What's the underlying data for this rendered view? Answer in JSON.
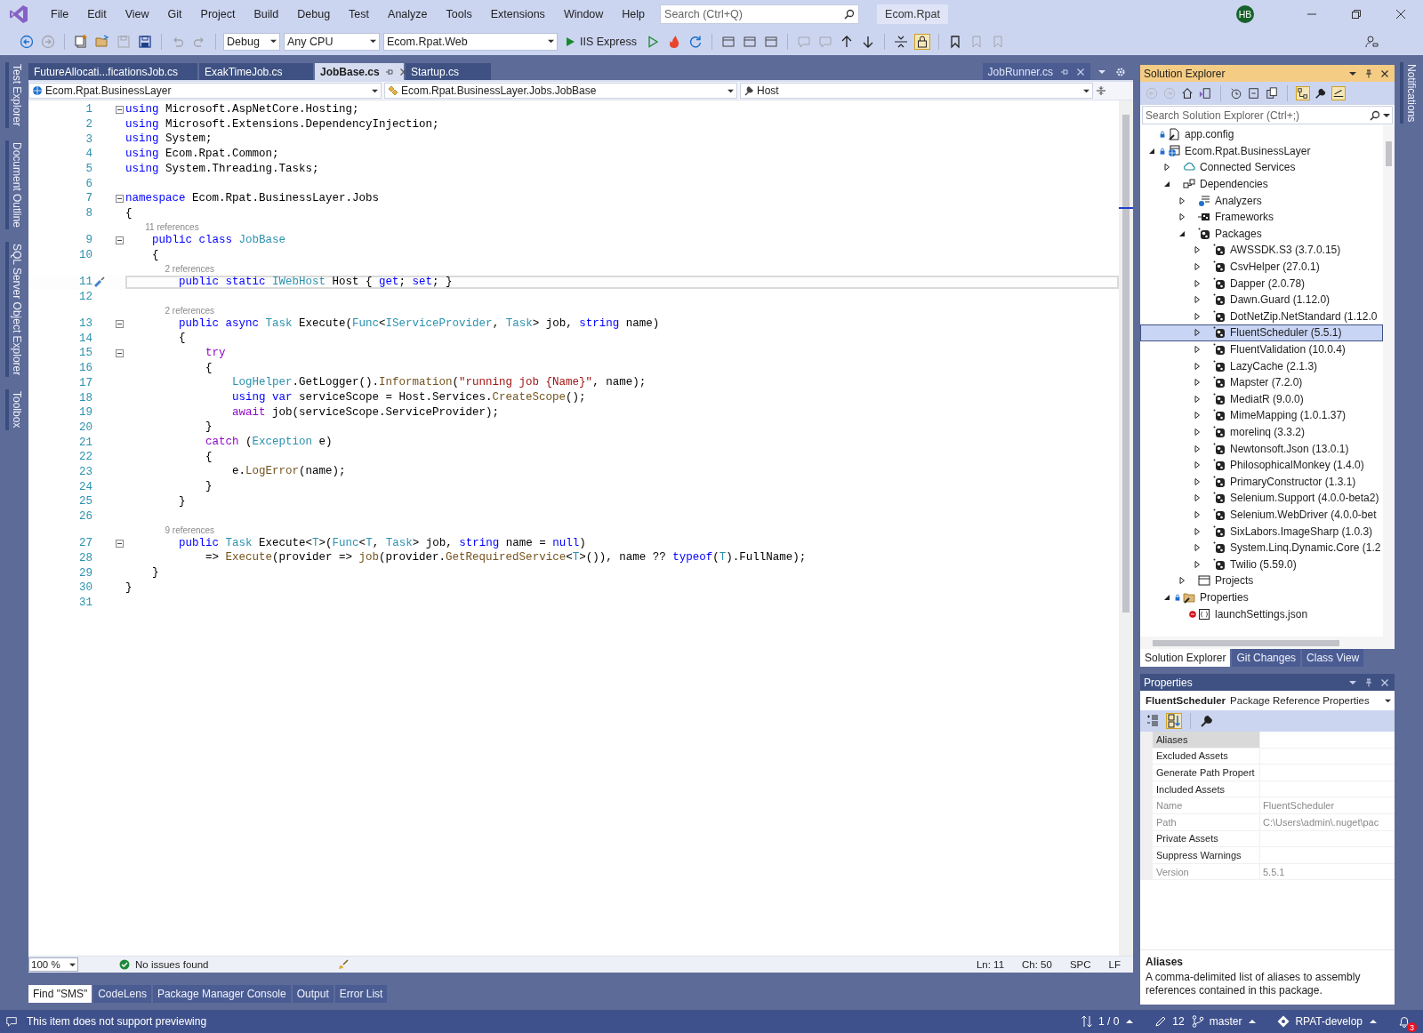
{
  "menu_bar": {
    "items": [
      "File",
      "Edit",
      "View",
      "Git",
      "Project",
      "Build",
      "Debug",
      "Test",
      "Analyze",
      "Tools",
      "Extensions",
      "Window",
      "Help"
    ],
    "search": {
      "placeholder": "Search (Ctrl+Q)"
    },
    "solution_name": "Ecom.Rpat",
    "user_initials": "HB"
  },
  "toolbar": {
    "configuration": "Debug",
    "platform": "Any CPU",
    "startup_project": "Ecom.Rpat.Web",
    "run_target": "IIS Express"
  },
  "left_tool_tabs": [
    "Test Explorer",
    "Document Outline",
    "SQL Server Object Explorer",
    "Toolbox"
  ],
  "right_tool_tabs": [
    "Notifications"
  ],
  "editor": {
    "tabs": [
      {
        "label": "FutureAllocati...ficationsJob.cs",
        "selected": false
      },
      {
        "label": "ExakTimeJob.cs",
        "selected": false
      },
      {
        "label": "JobBase.cs",
        "selected": true
      },
      {
        "label": "Startup.cs",
        "selected": false
      }
    ],
    "preview_tab": {
      "label": "JobRunner.cs"
    },
    "nav": {
      "project": "Ecom.Rpat.BusinessLayer",
      "type": "Ecom.Rpat.BusinessLayer.Jobs.JobBase",
      "member": "Host"
    },
    "lines": [
      {
        "kind": "code",
        "number": "1",
        "foldable": true,
        "current": false,
        "tokens": [
          {
            "t": "using",
            "kind": "kw"
          },
          {
            "t": " Microsoft.AspNetCore.Hosting;",
            "kind": "plain"
          }
        ]
      },
      {
        "kind": "code",
        "number": "2",
        "foldable": false,
        "current": false,
        "tokens": [
          {
            "t": "using",
            "kind": "kw"
          },
          {
            "t": " Microsoft.Extensions.DependencyInjection;",
            "kind": "plain"
          }
        ]
      },
      {
        "kind": "code",
        "number": "3",
        "foldable": false,
        "current": false,
        "tokens": [
          {
            "t": "using",
            "kind": "kw"
          },
          {
            "t": " System;",
            "kind": "plain"
          }
        ]
      },
      {
        "kind": "code",
        "number": "4",
        "foldable": false,
        "current": false,
        "tokens": [
          {
            "t": "using",
            "kind": "kw"
          },
          {
            "t": " Ecom.Rpat.Common;",
            "kind": "plain"
          }
        ]
      },
      {
        "kind": "code",
        "number": "5",
        "foldable": false,
        "current": false,
        "tokens": [
          {
            "t": "using",
            "kind": "kw"
          },
          {
            "t": " System.Threading.Tasks;",
            "kind": "plain"
          }
        ]
      },
      {
        "kind": "code",
        "number": "6",
        "foldable": false,
        "current": false
      },
      {
        "kind": "code",
        "number": "7",
        "foldable": true,
        "current": false,
        "tokens": [
          {
            "t": "namespace",
            "kind": "kw"
          },
          {
            "t": " Ecom.Rpat.BusinessLayer.Jobs",
            "kind": "plain"
          }
        ]
      },
      {
        "kind": "code",
        "number": "8",
        "foldable": false,
        "current": false,
        "tokens": [
          {
            "t": "{",
            "kind": "plain"
          }
        ]
      },
      {
        "kind": "lens",
        "text": "11 references"
      },
      {
        "kind": "code",
        "number": "9",
        "foldable": true,
        "current": false,
        "tokens": [
          {
            "t": "    public class",
            "kind": "kw"
          },
          {
            "t": " JobBase",
            "kind": "type"
          }
        ]
      },
      {
        "kind": "code",
        "number": "10",
        "foldable": false,
        "current": false,
        "tokens": [
          {
            "t": "    {",
            "kind": "plain"
          }
        ]
      },
      {
        "kind": "lens",
        "text": "2 references"
      },
      {
        "kind": "code",
        "number": "11",
        "foldable": false,
        "current": true,
        "tokens": [
          {
            "t": "        public static",
            "kind": "kw"
          },
          {
            "t": " IWebHost",
            "kind": "type"
          },
          {
            "t": " Host { ",
            "kind": "plain"
          },
          {
            "t": "get",
            "kind": "kw"
          },
          {
            "t": "; ",
            "kind": "plain"
          },
          {
            "t": "set",
            "kind": "kw"
          },
          {
            "t": "; }",
            "kind": "plain"
          }
        ]
      },
      {
        "kind": "code",
        "number": "12",
        "foldable": false,
        "current": false
      },
      {
        "kind": "lens",
        "text": "2 references"
      },
      {
        "kind": "code",
        "number": "13",
        "foldable": true,
        "current": false,
        "tokens": [
          {
            "t": "        public async",
            "kind": "kw"
          },
          {
            "t": " Task",
            "kind": "type"
          },
          {
            "t": " Execute(",
            "kind": "plain"
          },
          {
            "t": "Func",
            "kind": "type"
          },
          {
            "t": "<",
            "kind": "plain"
          },
          {
            "t": "IServiceProvider",
            "kind": "type"
          },
          {
            "t": ", ",
            "kind": "plain"
          },
          {
            "t": "Task",
            "kind": "type"
          },
          {
            "t": "> job, ",
            "kind": "plain"
          },
          {
            "t": "string",
            "kind": "kw"
          },
          {
            "t": " name)",
            "kind": "plain"
          }
        ]
      },
      {
        "kind": "code",
        "number": "14",
        "foldable": false,
        "current": false,
        "tokens": [
          {
            "t": "        {",
            "kind": "plain"
          }
        ]
      },
      {
        "kind": "code",
        "number": "15",
        "foldable": true,
        "current": false,
        "tokens": [
          {
            "t": "            try",
            "kind": "ctl"
          }
        ]
      },
      {
        "kind": "code",
        "number": "16",
        "foldable": false,
        "current": false,
        "tokens": [
          {
            "t": "            {",
            "kind": "plain"
          }
        ]
      },
      {
        "kind": "code",
        "number": "17",
        "foldable": false,
        "current": false,
        "tokens": [
          {
            "t": "                LogHelper",
            "kind": "type"
          },
          {
            "t": ".GetLogger().",
            "kind": "plain"
          },
          {
            "t": "Information",
            "kind": "method"
          },
          {
            "t": "(",
            "kind": "plain"
          },
          {
            "t": "\"running job {Name}\"",
            "kind": "str"
          },
          {
            "t": ", name);",
            "kind": "plain"
          }
        ]
      },
      {
        "kind": "code",
        "number": "18",
        "foldable": false,
        "current": false,
        "tokens": [
          {
            "t": "                using var",
            "kind": "kw"
          },
          {
            "t": " serviceScope = Host.Services.",
            "kind": "plain"
          },
          {
            "t": "CreateScope",
            "kind": "method"
          },
          {
            "t": "();",
            "kind": "plain"
          }
        ]
      },
      {
        "kind": "code",
        "number": "19",
        "foldable": false,
        "current": false,
        "tokens": [
          {
            "t": "                await",
            "kind": "ctl"
          },
          {
            "t": " job(serviceScope.ServiceProvider);",
            "kind": "plain"
          }
        ]
      },
      {
        "kind": "code",
        "number": "20",
        "foldable": false,
        "current": false,
        "tokens": [
          {
            "t": "            }",
            "kind": "plain"
          }
        ]
      },
      {
        "kind": "code",
        "number": "21",
        "foldable": false,
        "current": false,
        "tokens": [
          {
            "t": "            catch",
            "kind": "ctl"
          },
          {
            "t": " (",
            "kind": "plain"
          },
          {
            "t": "Exception",
            "kind": "type"
          },
          {
            "t": " e)",
            "kind": "plain"
          }
        ]
      },
      {
        "kind": "code",
        "number": "22",
        "foldable": false,
        "current": false,
        "tokens": [
          {
            "t": "            {",
            "kind": "plain"
          }
        ]
      },
      {
        "kind": "code",
        "number": "23",
        "foldable": false,
        "current": false,
        "tokens": [
          {
            "t": "                e.",
            "kind": "plain"
          },
          {
            "t": "LogError",
            "kind": "method"
          },
          {
            "t": "(name);",
            "kind": "plain"
          }
        ]
      },
      {
        "kind": "code",
        "number": "24",
        "foldable": false,
        "current": false,
        "tokens": [
          {
            "t": "            }",
            "kind": "plain"
          }
        ]
      },
      {
        "kind": "code",
        "number": "25",
        "foldable": false,
        "current": false,
        "tokens": [
          {
            "t": "        }",
            "kind": "plain"
          }
        ]
      },
      {
        "kind": "code",
        "number": "26",
        "foldable": false,
        "current": false
      },
      {
        "kind": "lens",
        "text": "9 references"
      },
      {
        "kind": "code",
        "number": "27",
        "foldable": true,
        "current": false,
        "tokens": [
          {
            "t": "        public",
            "kind": "kw"
          },
          {
            "t": " Task",
            "kind": "type"
          },
          {
            "t": " Execute<",
            "kind": "plain"
          },
          {
            "t": "T",
            "kind": "type"
          },
          {
            "t": ">(",
            "kind": "plain"
          },
          {
            "t": "Func",
            "kind": "type"
          },
          {
            "t": "<",
            "kind": "plain"
          },
          {
            "t": "T",
            "kind": "type"
          },
          {
            "t": ", ",
            "kind": "plain"
          },
          {
            "t": "Task",
            "kind": "type"
          },
          {
            "t": "> job, ",
            "kind": "plain"
          },
          {
            "t": "string",
            "kind": "kw"
          },
          {
            "t": " name = ",
            "kind": "plain"
          },
          {
            "t": "null",
            "kind": "kw"
          },
          {
            "t": ")",
            "kind": "plain"
          }
        ]
      },
      {
        "kind": "code",
        "number": "28",
        "foldable": false,
        "current": false,
        "tokens": [
          {
            "t": "            => ",
            "kind": "plain"
          },
          {
            "t": "Execute",
            "kind": "method"
          },
          {
            "t": "(provider => ",
            "kind": "plain"
          },
          {
            "t": "job",
            "kind": "method"
          },
          {
            "t": "(provider.",
            "kind": "plain"
          },
          {
            "t": "GetRequiredService",
            "kind": "method"
          },
          {
            "t": "<",
            "kind": "plain"
          },
          {
            "t": "T",
            "kind": "type"
          },
          {
            "t": ">()), name ?? ",
            "kind": "plain"
          },
          {
            "t": "typeof",
            "kind": "kw"
          },
          {
            "t": "(",
            "kind": "plain"
          },
          {
            "t": "T",
            "kind": "type"
          },
          {
            "t": ").FullName);",
            "kind": "plain"
          }
        ]
      },
      {
        "kind": "code",
        "number": "29",
        "foldable": false,
        "current": false,
        "tokens": [
          {
            "t": "    }",
            "kind": "plain"
          }
        ]
      },
      {
        "kind": "code",
        "number": "30",
        "foldable": false,
        "current": false,
        "tokens": [
          {
            "t": "}",
            "kind": "plain"
          }
        ]
      },
      {
        "kind": "code",
        "number": "31",
        "foldable": false,
        "current": false
      }
    ],
    "zoom": "100 %",
    "issues": "No issues found",
    "position": {
      "line": "Ln: 11",
      "column": "Ch: 50",
      "indentation": "SPC",
      "line_ending": "LF"
    }
  },
  "solution_explorer": {
    "title": "Solution Explorer",
    "search": {
      "placeholder": "Search Solution Explorer (Ctrl+;)"
    },
    "tree": [
      {
        "label": "app.config",
        "kind": "config",
        "locked": true,
        "excluded": false,
        "selected": false
      },
      {
        "label": "Ecom.Rpat.BusinessLayer",
        "kind": "project",
        "locked": true,
        "excluded": false,
        "expanded": true,
        "selected": false,
        "children": [
          {
            "label": "Connected Services",
            "kind": "services",
            "locked": false,
            "excluded": false,
            "expanded": false,
            "selected": false
          },
          {
            "label": "Dependencies",
            "kind": "dependencies",
            "locked": false,
            "excluded": false,
            "expanded": true,
            "selected": false,
            "children": [
              {
                "label": "Analyzers",
                "kind": "analyzers",
                "locked": false,
                "excluded": false,
                "expanded": false,
                "selected": false
              },
              {
                "label": "Frameworks",
                "kind": "frameworks",
                "locked": false,
                "excluded": false,
                "expanded": false,
                "selected": false
              },
              {
                "label": "Packages",
                "kind": "package",
                "locked": false,
                "excluded": false,
                "expanded": true,
                "selected": false,
                "children": [
                  {
                    "label": "AWSSDK.S3 (3.7.0.15)",
                    "kind": "package",
                    "locked": false,
                    "excluded": false,
                    "expanded": false,
                    "selected": false
                  },
                  {
                    "label": "CsvHelper (27.0.1)",
                    "kind": "package",
                    "locked": false,
                    "excluded": false,
                    "expanded": false,
                    "selected": false
                  },
                  {
                    "label": "Dapper (2.0.78)",
                    "kind": "package",
                    "locked": false,
                    "excluded": false,
                    "expanded": false,
                    "selected": false
                  },
                  {
                    "label": "Dawn.Guard (1.12.0)",
                    "kind": "package",
                    "locked": false,
                    "excluded": false,
                    "expanded": false,
                    "selected": false
                  },
                  {
                    "label": "DotNetZip.NetStandard (1.12.0",
                    "kind": "package",
                    "locked": false,
                    "excluded": false,
                    "expanded": false,
                    "selected": false
                  },
                  {
                    "label": "FluentScheduler (5.5.1)",
                    "kind": "package",
                    "locked": false,
                    "excluded": false,
                    "expanded": false,
                    "selected": true
                  },
                  {
                    "label": "FluentValidation (10.0.4)",
                    "kind": "package",
                    "locked": false,
                    "excluded": false,
                    "expanded": false,
                    "selected": false
                  },
                  {
                    "label": "LazyCache (2.1.3)",
                    "kind": "package",
                    "locked": false,
                    "excluded": false,
                    "expanded": false,
                    "selected": false
                  },
                  {
                    "label": "Mapster (7.2.0)",
                    "kind": "package",
                    "locked": false,
                    "excluded": false,
                    "expanded": false,
                    "selected": false
                  },
                  {
                    "label": "MediatR (9.0.0)",
                    "kind": "package",
                    "locked": false,
                    "excluded": false,
                    "expanded": false,
                    "selected": false
                  },
                  {
                    "label": "MimeMapping (1.0.1.37)",
                    "kind": "package",
                    "locked": false,
                    "excluded": false,
                    "expanded": false,
                    "selected": false
                  },
                  {
                    "label": "morelinq (3.3.2)",
                    "kind": "package",
                    "locked": false,
                    "excluded": false,
                    "expanded": false,
                    "selected": false
                  },
                  {
                    "label": "Newtonsoft.Json (13.0.1)",
                    "kind": "package",
                    "locked": false,
                    "excluded": false,
                    "expanded": false,
                    "selected": false
                  },
                  {
                    "label": "PhilosophicalMonkey (1.4.0)",
                    "kind": "package",
                    "locked": false,
                    "excluded": false,
                    "expanded": false,
                    "selected": false
                  },
                  {
                    "label": "PrimaryConstructor (1.3.1)",
                    "kind": "package",
                    "locked": false,
                    "excluded": false,
                    "expanded": false,
                    "selected": false
                  },
                  {
                    "label": "Selenium.Support (4.0.0-beta2)",
                    "kind": "package",
                    "locked": false,
                    "excluded": false,
                    "expanded": false,
                    "selected": false
                  },
                  {
                    "label": "Selenium.WebDriver (4.0.0-bet",
                    "kind": "package",
                    "locked": false,
                    "excluded": false,
                    "expanded": false,
                    "selected": false
                  },
                  {
                    "label": "SixLabors.ImageSharp (1.0.3)",
                    "kind": "package",
                    "locked": false,
                    "excluded": false,
                    "expanded": false,
                    "selected": false
                  },
                  {
                    "label": "System.Linq.Dynamic.Core (1.2",
                    "kind": "package",
                    "locked": false,
                    "excluded": false,
                    "expanded": false,
                    "selected": false
                  },
                  {
                    "label": "Twilio (5.59.0)",
                    "kind": "package",
                    "locked": false,
                    "excluded": false,
                    "expanded": false,
                    "selected": false
                  }
                ]
              },
              {
                "label": "Projects",
                "kind": "projects",
                "locked": false,
                "excluded": false,
                "expanded": false,
                "selected": false
              }
            ]
          },
          {
            "label": "Properties",
            "kind": "properties",
            "locked": true,
            "excluded": false,
            "expanded": true,
            "selected": false,
            "children": [
              {
                "label": "launchSettings.json",
                "kind": "json",
                "locked": false,
                "excluded": true,
                "selected": false
              }
            ]
          }
        ]
      }
    ],
    "tabs": [
      {
        "label": "Solution Explorer",
        "selected": true
      },
      {
        "label": "Git Changes",
        "selected": false
      },
      {
        "label": "Class View",
        "selected": false
      }
    ]
  },
  "properties": {
    "title": "Properties",
    "object_name": "FluentScheduler",
    "object_type": "Package Reference Properties",
    "rows": [
      {
        "name": "Aliases",
        "readonly": false,
        "selected": true
      },
      {
        "name": "Excluded Assets",
        "readonly": false,
        "selected": false
      },
      {
        "name": "Generate Path Propert",
        "readonly": false,
        "selected": false
      },
      {
        "name": "Included Assets",
        "readonly": false,
        "selected": false
      },
      {
        "name": "Name",
        "value": "FluentScheduler",
        "readonly": true,
        "selected": false
      },
      {
        "name": "Path",
        "value": "C:\\Users\\admin\\.nuget\\pac",
        "readonly": true,
        "selected": false
      },
      {
        "name": "Private Assets",
        "readonly": false,
        "selected": false
      },
      {
        "name": "Suppress Warnings",
        "readonly": false,
        "selected": false
      },
      {
        "name": "Version",
        "value": "5.5.1",
        "readonly": true,
        "selected": false
      }
    ],
    "description": {
      "title": "Aliases",
      "text": "A comma-delimited list of aliases to assembly references contained in this package."
    }
  },
  "bottom_tabs": [
    {
      "label": "Find \"SMS\"",
      "selected": true
    },
    {
      "label": "CodeLens",
      "selected": false
    },
    {
      "label": "Package Manager Console",
      "selected": false
    },
    {
      "label": "Output",
      "selected": false
    },
    {
      "label": "Error List",
      "selected": false
    }
  ],
  "status_bar": {
    "message": "This item does not support previewing",
    "changes": "1 / 0",
    "edits": "12",
    "branch": "master",
    "repository": "RPAT-develop",
    "notifications": "3"
  }
}
